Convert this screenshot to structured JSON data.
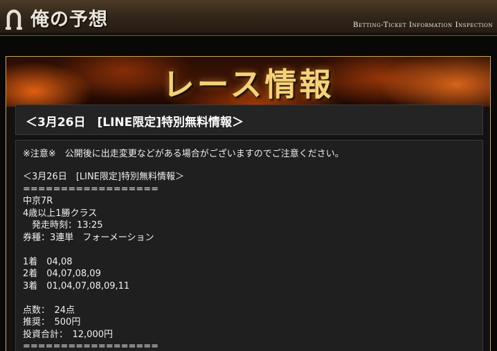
{
  "header": {
    "logo_icon": "horseshoe-icon",
    "title": "俺の予想",
    "subtitle": "Betting-Ticket Information Inspection"
  },
  "banner": {
    "title": "レース情報"
  },
  "post": {
    "heading": "＜3月26日　[LINE限定]特別無料情報＞",
    "notice": "※注意※　公開後に出走変更などがある場合がございますのでご注意ください。",
    "lines": [
      "＜3月26日　[LINE限定]特別無料情報＞",
      "==================",
      "中京7R",
      "4歳以上1勝クラス",
      "　発走時刻：13:25",
      "券種：3連単　フォーメーション",
      "",
      "1着　04,08",
      "2着　04,07,08,09",
      "3着　01,04,07,08,09,11",
      "",
      "点数：　24点",
      "推奨：　500円",
      "投資合計：　12,000円",
      "=================="
    ]
  },
  "colors": {
    "header_bg": "#2f2418",
    "frame_border": "#c9a65a",
    "banner_text": "#f3d27a",
    "panel_bg": "#1f1f1f"
  }
}
